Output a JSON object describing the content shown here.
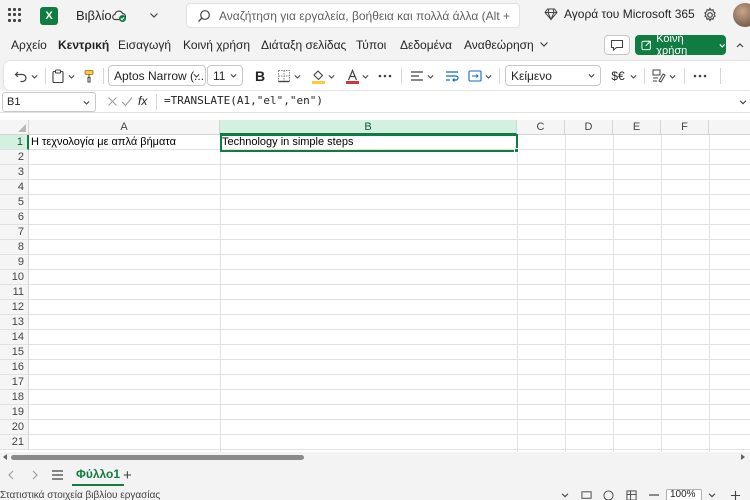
{
  "titlebar": {
    "app_letter": "X",
    "document_name": "Βιβλίο",
    "search_placeholder": "Αναζήτηση για εργαλεία, βοήθεια και πολλά άλλα (Alt + X)",
    "buy_label": "Αγορά του Microsoft 365"
  },
  "ribbon": {
    "tabs": [
      "Αρχείο",
      "Κεντρική",
      "Εισαγωγή",
      "Κοινή χρήση",
      "Διάταξη σελίδας",
      "Τύποι",
      "Δεδομένα",
      "Αναθεώρηση"
    ],
    "active_tab": "Κεντρική",
    "share_label": "Κοινή χρήση",
    "font_name": "Aptos Narrow (...",
    "font_size": "11",
    "bold_label": "B",
    "number_format": "Κείμενο",
    "currency_label": "$€",
    "accent_color": "#107c41",
    "font_color": "#d13438",
    "highlight_color": "#ffc83d"
  },
  "formula_bar": {
    "name_box": "B1",
    "fx_label": "fx",
    "formula": "=TRANSLATE(A1,\"el\",\"en\")"
  },
  "sheet": {
    "columns": [
      "A",
      "B",
      "C",
      "D",
      "E",
      "F"
    ],
    "selected_column": "B",
    "rows": [
      "1",
      "2",
      "3",
      "4",
      "5",
      "6",
      "7",
      "8",
      "9",
      "10",
      "11",
      "12",
      "13",
      "14",
      "15",
      "16",
      "17",
      "18",
      "19",
      "20",
      "21"
    ],
    "selected_row": "1",
    "cells": {
      "A1": "Η τεχνολογία με απλά βήματα",
      "B1": "Technology in simple steps"
    },
    "active_cell": "B1"
  },
  "sheet_tabs": {
    "sheets": [
      "Φύλλο1"
    ],
    "add_label": "+"
  },
  "status": {
    "text": "Στατιστικά στοιχεία βιβλίου εργασίας",
    "zoom": "100%"
  }
}
